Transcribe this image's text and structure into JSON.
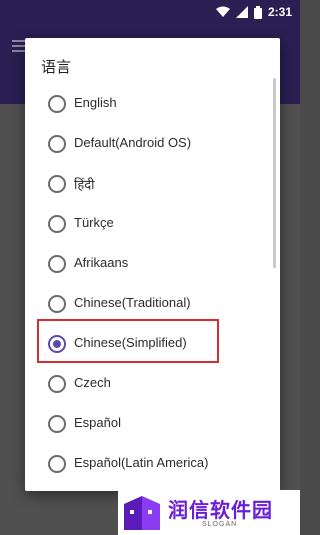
{
  "status_bar": {
    "time": "2:31",
    "icons": [
      "wifi-icon",
      "signal-icon",
      "battery-icon"
    ]
  },
  "dialog": {
    "title": "语言",
    "options": [
      {
        "label": "English",
        "selected": false
      },
      {
        "label": "Default(Android OS)",
        "selected": false
      },
      {
        "label": "हिंदी",
        "selected": false
      },
      {
        "label": "Türkçe",
        "selected": false
      },
      {
        "label": "Afrikaans",
        "selected": false
      },
      {
        "label": "Chinese(Traditional)",
        "selected": false
      },
      {
        "label": "Chinese(Simplified)",
        "selected": true
      },
      {
        "label": "Czech",
        "selected": false
      },
      {
        "label": "Español",
        "selected": false
      },
      {
        "label": "Español(Latin America)",
        "selected": false
      }
    ]
  },
  "watermark": {
    "name": "润信软件园",
    "slogan": "SLOGAN"
  },
  "colors": {
    "appbar": "#2a1f52",
    "accent": "#5b4bb1",
    "highlight": "#d32f2f",
    "watermark": "#6a1fd6"
  }
}
